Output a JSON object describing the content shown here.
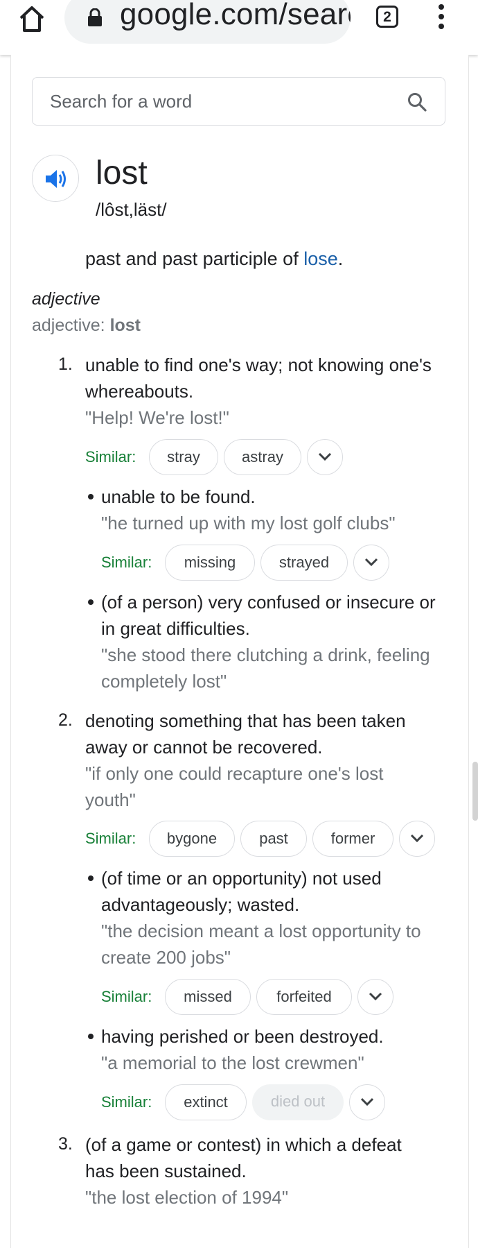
{
  "browser": {
    "url": "google.com/searc",
    "tab_count": "2"
  },
  "search": {
    "placeholder": "Search for a word"
  },
  "entry": {
    "word": "lost",
    "phonetic": "/lôst,läst/",
    "past_prefix": "past and past participle of ",
    "past_link": "lose",
    "past_suffix": ".",
    "part_of_speech": "adjective",
    "forms_label": "adjective: ",
    "forms_word": "lost"
  },
  "similar_label": "Similar:",
  "senses": [
    {
      "number": "1.",
      "definition_lines": [
        "unable to find one's way; not knowing one's",
        "whereabouts."
      ],
      "example_lines": [
        "\"Help! We're lost!\""
      ],
      "similar": [
        "stray",
        "astray"
      ],
      "subsenses": [
        {
          "definition_lines": [
            "unable to be found."
          ],
          "example_lines": [
            "\"he turned up with my lost golf clubs\""
          ],
          "similar": [
            "missing",
            "strayed"
          ]
        },
        {
          "definition_lines": [
            "(of a person) very confused or insecure or",
            "in great difficulties."
          ],
          "example_lines": [
            "\"she stood there clutching a drink, feeling",
            "completely lost\""
          ]
        }
      ]
    },
    {
      "number": "2.",
      "definition_lines": [
        "denoting something that has been taken",
        "away or cannot be recovered."
      ],
      "example_lines": [
        "\"if only one could recapture one's lost",
        "youth\""
      ],
      "similar": [
        "bygone",
        "past",
        "former"
      ],
      "subsenses": [
        {
          "definition_lines": [
            "(of time or an opportunity) not used",
            "advantageously; wasted."
          ],
          "example_lines": [
            "\"the decision meant a lost opportunity to",
            "create 200 jobs\""
          ],
          "similar": [
            "missed",
            "forfeited"
          ]
        },
        {
          "definition_lines": [
            "having perished or been destroyed."
          ],
          "example_lines": [
            "\"a memorial to the lost crewmen\""
          ],
          "similar": [
            "extinct",
            "died out"
          ]
        }
      ]
    },
    {
      "number": "3.",
      "definition_lines": [
        "(of a game or contest) in which a defeat",
        "has been sustained."
      ],
      "example_lines": [
        "\"the lost election of 1994\""
      ]
    }
  ],
  "colors": {
    "similar_label": "#188038",
    "link": "#1a5fa8",
    "speaker_icon": "#1a73e8",
    "muted_text": "#70757a"
  }
}
